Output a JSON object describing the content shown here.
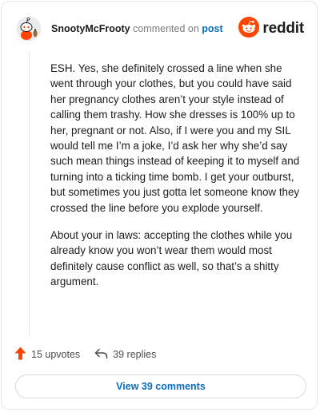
{
  "header": {
    "username": "SnootyMcFrooty",
    "action_text": "commented on",
    "post_link": "post",
    "brand_name": "reddit",
    "avatar_icon": "snoo-avatar-icon",
    "brand_icon": "reddit-logo-icon"
  },
  "comment": {
    "paragraphs": [
      "ESH. Yes, she definitely crossed a line when she went through your clothes, but you could have said her pregnancy clothes aren’t your style instead of calling them trashy. How she dresses is 100% up to her, pregnant or not. Also, if I were you and my SIL would tell me I’m a joke, I’d ask her why she’d say such mean things instead of keeping it to myself and turning into a ticking time bomb. I get your outburst, but sometimes you just gotta let someone know they crossed the line before you explode yourself.",
      "About your in laws: accepting the clothes while you already know you won’t wear them would most definitely cause conflict as well, so that’s a shitty argument."
    ]
  },
  "actions": {
    "upvotes": "15 upvotes",
    "replies": "39 replies",
    "upvote_icon": "upvote-arrow-icon",
    "reply_icon": "reply-arrow-icon"
  },
  "view_button": {
    "label": "View 39 comments"
  },
  "colors": {
    "brand_orange": "#ff4500",
    "link_blue": "#0a6cc2",
    "muted_text": "#7c7c7c",
    "border": "#e3e6e8"
  }
}
